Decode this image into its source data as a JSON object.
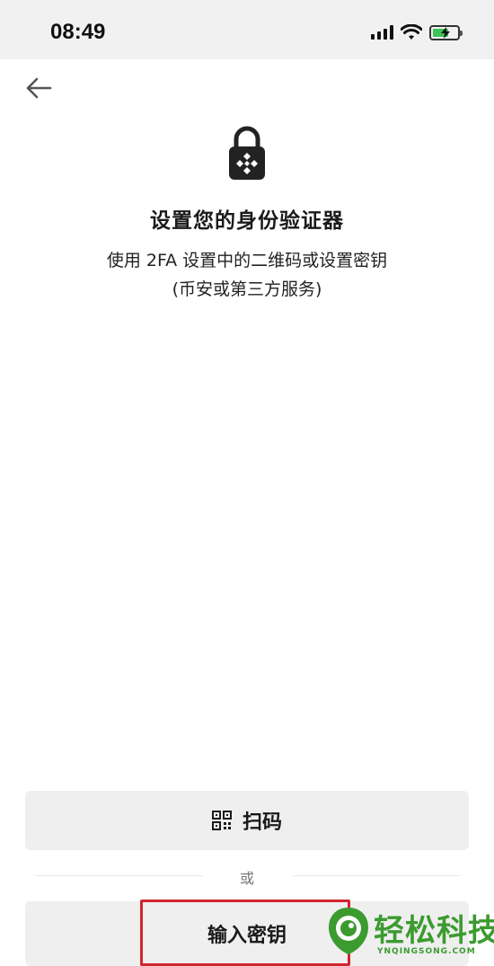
{
  "status_bar": {
    "time": "08:49"
  },
  "header": {
    "back_icon": "arrow-left-icon"
  },
  "hero": {
    "icon": "lock-binance-icon",
    "title": "设置您的身份验证器",
    "subtitle_line1": "使用 2FA 设置中的二维码或设置密钥",
    "subtitle_line2": "(币安或第三方服务)"
  },
  "actions": {
    "scan_icon": "qr-code-icon",
    "scan_label": "扫码",
    "or_text": "或",
    "key_label": "输入密钥"
  },
  "annotation": {
    "highlight_color": "#d0262e"
  },
  "watermark": {
    "title": "轻松科技",
    "subtitle": "YNQINGSONG.COM",
    "color": "#3b9b2f"
  }
}
